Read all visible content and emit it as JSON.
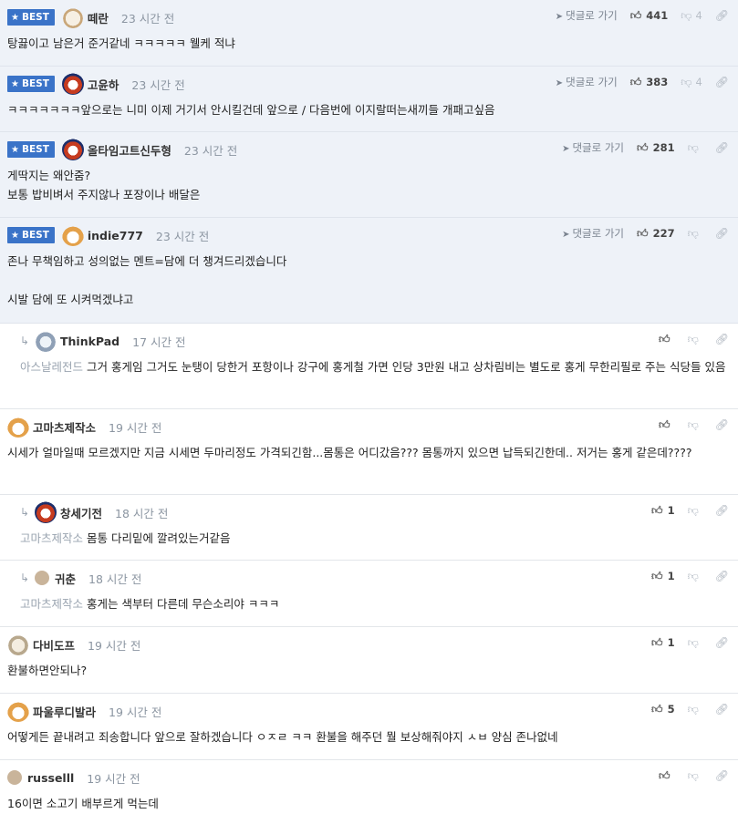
{
  "labels": {
    "best": "BEST",
    "goto": "댓글로 가기"
  },
  "colors": {
    "best_badge": "#3a73c8",
    "best_bg": "#eef2f8",
    "muted": "#8b95a1"
  },
  "icons": {
    "star": "star-icon",
    "goto": "send-arrow-icon",
    "up": "thumbs-up-icon",
    "down": "thumbs-down-icon",
    "link": "link-icon",
    "reply": "reply-arrow-icon"
  },
  "comments": [
    {
      "best": true,
      "nick": "떼란",
      "time": "23 시간 전",
      "goto": true,
      "up": "441",
      "down": "4",
      "lines": [
        "탕끓이고 남은거 준거같네 ㅋㅋㅋㅋㅋ 웰케 적냐"
      ]
    },
    {
      "best": true,
      "nick": "고윤하",
      "time": "23 시간 전",
      "goto": true,
      "up": "383",
      "down": "4",
      "lines": [
        "ㅋㅋㅋㅋㅋㅋㅋ앞으로는 니미 이제 거기서 안시킬건데 앞으로 / 다음번에 이지랄떠는새끼들 개패고싶음"
      ]
    },
    {
      "best": true,
      "nick": "올타임고트신두형",
      "time": "23 시간 전",
      "goto": true,
      "up": "281",
      "down": "",
      "lines": [
        "게딱지는 왜안줌?",
        "보통 밥비벼서 주지않나 포장이나 배달은"
      ]
    },
    {
      "best": true,
      "nick": "indie777",
      "time": "23 시간 전",
      "goto": true,
      "up": "227",
      "down": "",
      "lines": [
        "존나 무책임하고 성의없는 멘트=담에 더 챙겨드리겠습니다",
        "",
        "시발 담에 또 시켜먹겠냐고"
      ]
    },
    {
      "best": false,
      "reply": true,
      "nick": "ThinkPad",
      "time": "17 시간 전",
      "up": "",
      "down": "",
      "mention": "아스날레전드",
      "lines": [
        "그거 홍게임 그거도 눈탱이 당한거 포항이나 강구에 홍게철 가면 인당 3만원 내고 상차림비는 별도로 홍게 무한리필로 주는 식당들 있음"
      ]
    },
    {
      "best": false,
      "nick": "고마츠제작소",
      "time": "19 시간 전",
      "up": "",
      "down": "",
      "lines": [
        "시세가 얼마일때 모르겠지만 지금 시세면 두마리정도 가격되긴함...몸통은 어디갔음??? 몸통까지 있으면 납득되긴한데.. 저거는 홍게 같은데????"
      ]
    },
    {
      "best": false,
      "reply": true,
      "nick": "창세기전",
      "time": "18 시간 전",
      "up": "1",
      "down": "",
      "mention": "고마츠제작소",
      "lines": [
        "몸통 다리밑에 깔려있는거같음"
      ]
    },
    {
      "best": false,
      "reply": true,
      "nick": "귀춘",
      "time": "18 시간 전",
      "up": "1",
      "down": "",
      "mention": "고마츠제작소",
      "lines": [
        "홍게는 색부터 다른데 무슨소리야 ㅋㅋㅋ"
      ]
    },
    {
      "best": false,
      "nick": "다비도프",
      "time": "19 시간 전",
      "up": "1",
      "down": "",
      "lines": [
        "환불하면안되나?"
      ]
    },
    {
      "best": false,
      "nick": "파울루디발라",
      "time": "19 시간 전",
      "up": "5",
      "down": "",
      "lines": [
        "어떻게든 끝내려고 죄송합니다 앞으로 잘하겠습니다 ㅇㅈㄹ ㅋㅋ 환불을 해주던 뭘 보상해줘야지 ㅅㅂ 양심 존나없네"
      ]
    },
    {
      "best": false,
      "nick": "russelll",
      "time": "19 시간 전",
      "up": "",
      "down": "",
      "lines": [
        "16이면 소고기 배부르게 먹는데"
      ]
    }
  ]
}
